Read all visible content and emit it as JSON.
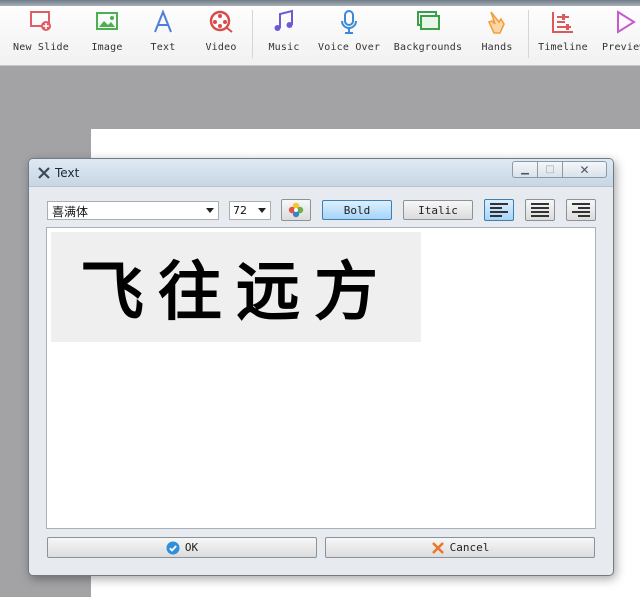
{
  "toolbar": {
    "items": [
      {
        "label": "New Slide",
        "icon": "new-slide-icon",
        "color": "#e05c67"
      },
      {
        "label": "Image",
        "icon": "image-icon",
        "color": "#4caf50"
      },
      {
        "label": "Text",
        "icon": "text-icon",
        "color": "#4f7fd9"
      },
      {
        "label": "Video",
        "icon": "video-icon",
        "color": "#d94a4a"
      },
      {
        "label": "Music",
        "icon": "music-icon",
        "color": "#6b5ad6"
      },
      {
        "label": "Voice Over",
        "icon": "microphone-icon",
        "color": "#3b8ad9"
      },
      {
        "label": "Backgrounds",
        "icon": "backgrounds-icon",
        "color": "#3ca04a"
      },
      {
        "label": "Hands",
        "icon": "hand-icon",
        "color": "#f0a040"
      },
      {
        "label": "Timeline",
        "icon": "timeline-icon",
        "color": "#d95a5a"
      },
      {
        "label": "Preview",
        "icon": "preview-icon",
        "color": "#c85ad0"
      }
    ]
  },
  "dialog": {
    "title": "Text",
    "font": "喜满体",
    "size": "72",
    "bold_label": "Bold",
    "italic_label": "Italic",
    "preview_text": "飞往远方",
    "ok_label": "OK",
    "cancel_label": "Cancel",
    "accent_color": "#a7d4f7"
  }
}
